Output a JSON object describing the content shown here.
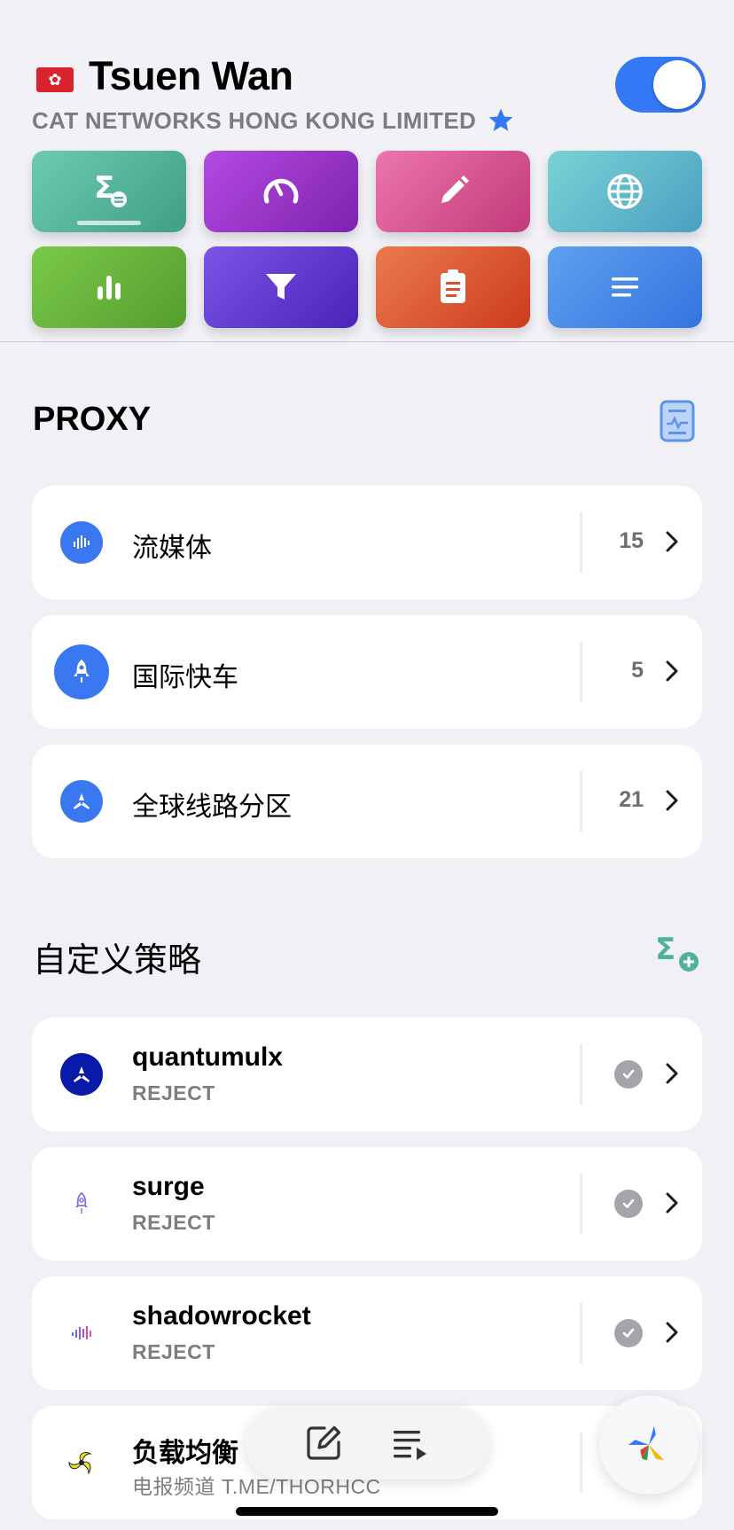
{
  "header": {
    "flag": "🇭🇰",
    "city": "Tsuen Wan",
    "provider": "CAT NETWORKS HONG KONG LIMITED",
    "toggle_on": true,
    "tiles": [
      {
        "icon": "policy-sum-icon",
        "color": "#4fb39a"
      },
      {
        "icon": "speedometer-icon",
        "color": "#9b2fc4"
      },
      {
        "icon": "pencil-icon",
        "color": "#d6508e"
      },
      {
        "icon": "globe-icon",
        "color": "#5bbac8"
      },
      {
        "icon": "bar-chart-icon",
        "color": "#66b03f"
      },
      {
        "icon": "filter-icon",
        "color": "#5b3bd0"
      },
      {
        "icon": "clipboard-icon",
        "color": "#de5a33"
      },
      {
        "icon": "lines-icon",
        "color": "#4a8be8"
      }
    ]
  },
  "proxy": {
    "title": "PROXY",
    "items": [
      {
        "name": "流媒体",
        "count": "15"
      },
      {
        "name": "国际快车",
        "count": "5"
      },
      {
        "name": "全球线路分区",
        "count": "21"
      }
    ]
  },
  "custom": {
    "title": "自定义策略",
    "items": [
      {
        "name": "quantumulx",
        "sub": "REJECT"
      },
      {
        "name": "surge",
        "sub": "REJECT"
      },
      {
        "name": "shadowrocket",
        "sub": "REJECT"
      },
      {
        "name": "负载均衡",
        "sub": "电报频道 T.ME/THORHCC"
      }
    ]
  }
}
